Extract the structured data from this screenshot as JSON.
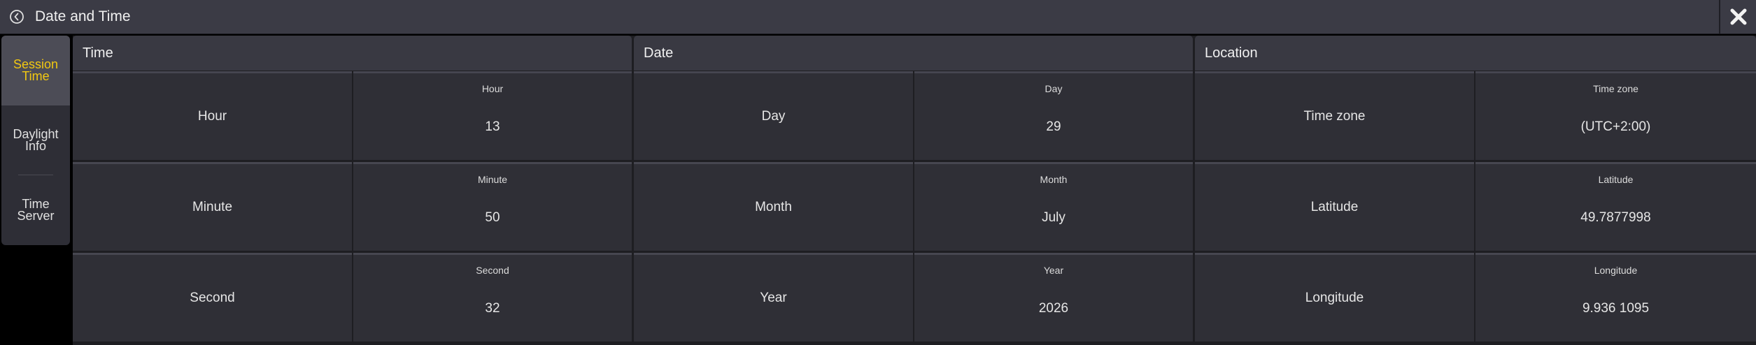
{
  "window": {
    "title": "Date and Time",
    "icons": {
      "back": "clock-back-icon",
      "close": "close-x-icon"
    }
  },
  "sidebar": {
    "items": [
      {
        "label": "Session Time",
        "active": true
      },
      {
        "label": "Daylight Info",
        "active": false
      },
      {
        "label": "Time Server",
        "active": false
      }
    ]
  },
  "sections": [
    {
      "header": "Time",
      "rows": [
        {
          "label": "Hour",
          "value_label": "Hour",
          "value": "13"
        },
        {
          "label": "Minute",
          "value_label": "Minute",
          "value": "50"
        },
        {
          "label": "Second",
          "value_label": "Second",
          "value": "32"
        }
      ]
    },
    {
      "header": "Date",
      "rows": [
        {
          "label": "Day",
          "value_label": "Day",
          "value": "29"
        },
        {
          "label": "Month",
          "value_label": "Month",
          "value": "July"
        },
        {
          "label": "Year",
          "value_label": "Year",
          "value": "2026"
        }
      ]
    },
    {
      "header": "Location",
      "rows": [
        {
          "label": "Time zone",
          "value_label": "Time zone",
          "value": "(UTC+2:00)"
        },
        {
          "label": "Latitude",
          "value_label": "Latitude",
          "value": "49.7877998"
        },
        {
          "label": "Longitude",
          "value_label": "Longitude",
          "value": "9.936 1095"
        }
      ]
    }
  ],
  "colors": {
    "active_text": "#f2c811",
    "background": "#000000",
    "panel": "#2f2f36",
    "header": "#393942"
  }
}
